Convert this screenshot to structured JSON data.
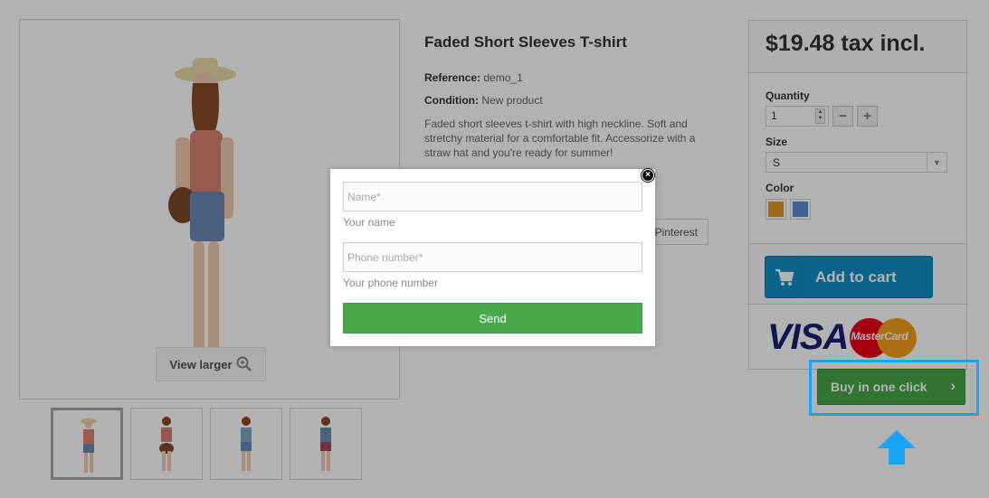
{
  "product": {
    "title": "Faded Short Sleeves T-shirt",
    "reference_label": "Reference:",
    "reference_value": "demo_1",
    "condition_label": "Condition:",
    "condition_value": "New product",
    "description": "Faded short sleeves t-shirt with high neckline. Soft and stretchy material for a comfortable fit. Accessorize with a straw hat and you're ready for summer!",
    "view_larger": "View larger",
    "pinterest": "Pinterest"
  },
  "buybox": {
    "price": "$19.48 tax incl.",
    "quantity_label": "Quantity",
    "quantity_value": "1",
    "minus": "−",
    "plus": "+",
    "size_label": "Size",
    "size_value": "S",
    "color_label": "Color",
    "colors": [
      "#e29a2a",
      "#5a8ad2"
    ],
    "add_to_cart": "Add to cart",
    "visa": "VISA",
    "mastercard": "MasterCard"
  },
  "buy_one_click": {
    "label": "Buy in one click",
    "icon": "chevron-right-icon",
    "highlight_color": "#1aa3f5"
  },
  "modal": {
    "name_placeholder": "Name*",
    "name_hint": "Your name",
    "phone_placeholder": "Phone number*",
    "phone_hint": "Your phone number",
    "send": "Send",
    "close_icon": "close-icon",
    "send_color": "#48a84a"
  }
}
